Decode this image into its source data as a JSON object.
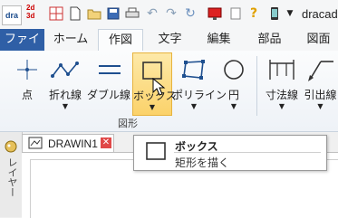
{
  "app": {
    "logo_text": "dra",
    "logo_2d": "2d",
    "logo_3d": "3d",
    "title": "dracad"
  },
  "tabs": [
    {
      "label": "ファイル"
    },
    {
      "label": "ホーム"
    },
    {
      "label": "作図"
    },
    {
      "label": "文字"
    },
    {
      "label": "編集"
    },
    {
      "label": "部品"
    },
    {
      "label": "図面"
    }
  ],
  "ribbon": {
    "buttons": [
      {
        "label": "点",
        "icon": "point-icon"
      },
      {
        "label": "折れ線",
        "icon": "polyline-icon"
      },
      {
        "label": "ダブル線",
        "icon": "double-line-icon"
      },
      {
        "label": "ボックス",
        "icon": "box-icon"
      },
      {
        "label": "ポリライン",
        "icon": "polygon-icon"
      },
      {
        "label": "円",
        "icon": "circle-icon"
      },
      {
        "label": "寸法線",
        "icon": "dimension-icon"
      },
      {
        "label": "引出線",
        "icon": "leader-icon"
      }
    ],
    "group_label": "図形"
  },
  "document": {
    "tab_title": "DRAWIN1",
    "side_label": "レイヤー"
  },
  "tooltip": {
    "title": "ボックス",
    "description": "矩形を描く"
  },
  "colors": {
    "accent": "#2f5fa6",
    "highlight": "#fbd26a"
  }
}
